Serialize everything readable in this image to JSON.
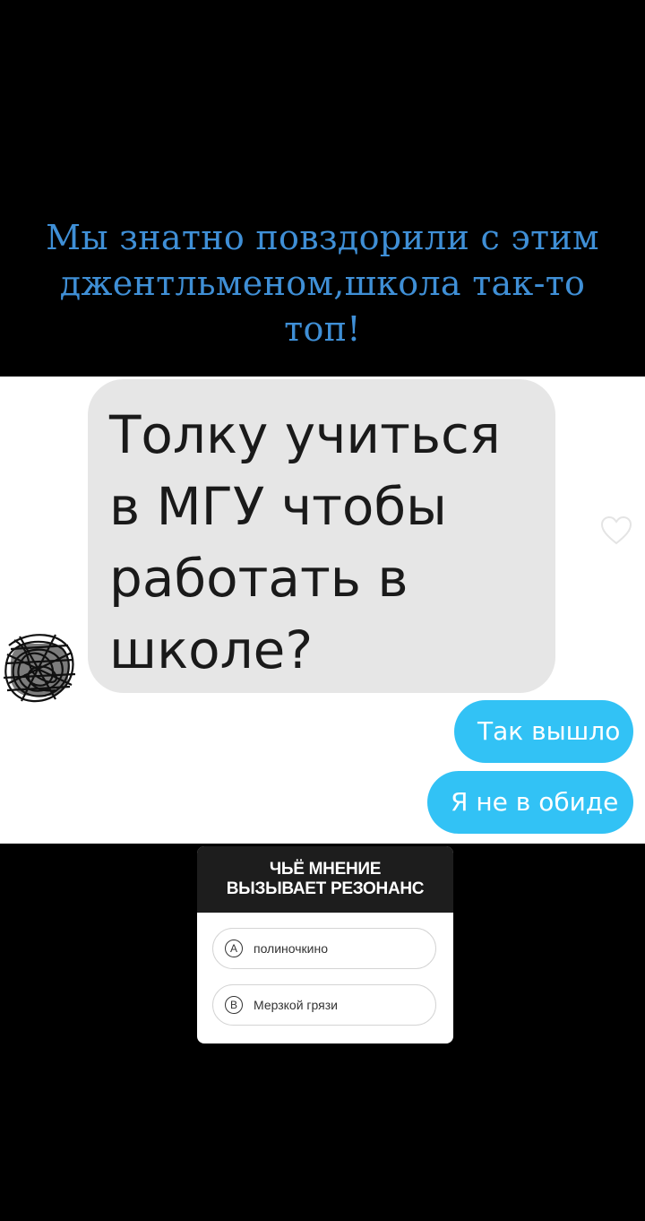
{
  "caption": {
    "lines": [
      "Мы знатно повздорили с этим",
      "джентльменом,школа так-то",
      "топ!"
    ]
  },
  "chat": {
    "incoming": {
      "lines": [
        "Толку учиться",
        "в МГУ чтобы",
        "работать в",
        "школе?"
      ]
    },
    "outgoing": [
      "Так вышло",
      "Я не в обиде"
    ],
    "colors": {
      "incoming_bg": "#e6e6e6",
      "outgoing_bg": "#32c2f5"
    },
    "icons": {
      "reaction": "heart-icon",
      "avatar": "scribbled-avatar"
    }
  },
  "quiz": {
    "title_lines": [
      "ЧЬЁ МНЕНИЕ",
      "ВЫЗЫВАЕТ РЕЗОНАНС"
    ],
    "options": [
      {
        "letter": "A",
        "text": "полиночкино"
      },
      {
        "letter": "B",
        "text": "Мерзкой грязи"
      }
    ]
  },
  "colors": {
    "caption": "#3f8fd6",
    "background": "#000000"
  }
}
